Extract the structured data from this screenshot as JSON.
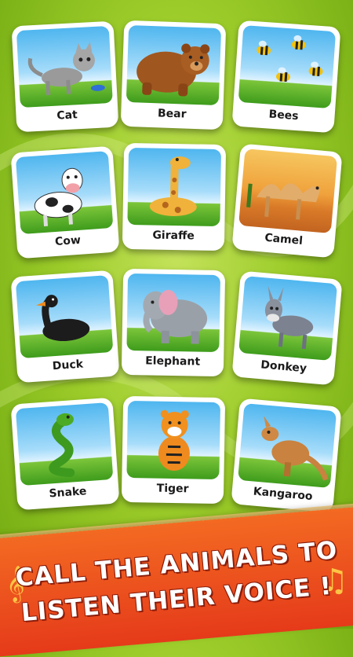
{
  "animals": [
    {
      "label": "Cat"
    },
    {
      "label": "Bear"
    },
    {
      "label": "Bees"
    },
    {
      "label": "Cow"
    },
    {
      "label": "Giraffe"
    },
    {
      "label": "Camel"
    },
    {
      "label": "Duck"
    },
    {
      "label": "Elephant"
    },
    {
      "label": "Donkey"
    },
    {
      "label": "Snake"
    },
    {
      "label": "Tiger"
    },
    {
      "label": "Kangaroo"
    }
  ],
  "banner": {
    "line1": "CALL THE ANIMALS TO",
    "line2": "LISTEN THEIR VOICE !"
  },
  "colors": {
    "background": "#9ccc2a",
    "banner": "#e8441c",
    "banner_text": "#ffffff"
  }
}
